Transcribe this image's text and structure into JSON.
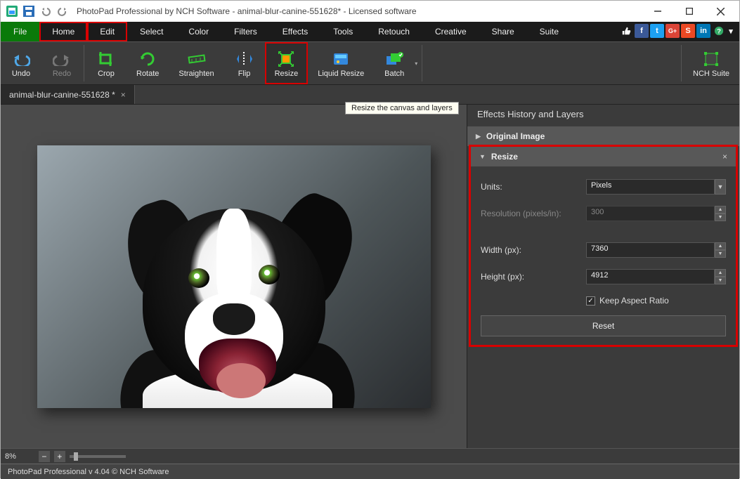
{
  "title": "PhotoPad Professional by NCH Software - animal-blur-canine-551628* - Licensed software",
  "menu": {
    "file": "File",
    "home": "Home",
    "edit": "Edit",
    "select": "Select",
    "color": "Color",
    "filters": "Filters",
    "effects": "Effects",
    "tools": "Tools",
    "retouch": "Retouch",
    "creative": "Creative",
    "share": "Share",
    "suite": "Suite"
  },
  "ribbon": {
    "undo": "Undo",
    "redo": "Redo",
    "crop": "Crop",
    "rotate": "Rotate",
    "straighten": "Straighten",
    "flip": "Flip",
    "resize": "Resize",
    "liquid": "Liquid Resize",
    "batch": "Batch",
    "nch": "NCH Suite"
  },
  "tab": {
    "name": "animal-blur-canine-551628 *",
    "close": "×"
  },
  "tooltip": "Resize the canvas and layers",
  "panel": {
    "header": "Effects History and Layers",
    "original": "Original Image",
    "resize_title": "Resize",
    "units_label": "Units:",
    "units_value": "Pixels",
    "res_label": "Resolution (pixels/in):",
    "res_value": "300",
    "width_label": "Width (px):",
    "width_value": "7360",
    "height_label": "Height (px):",
    "height_value": "4912",
    "keep_aspect": "Keep Aspect Ratio",
    "reset": "Reset",
    "close": "×"
  },
  "zoom": {
    "pct": "8%"
  },
  "status": "PhotoPad Professional v 4.04 © NCH Software",
  "social": {
    "fb": "f",
    "tw": "t",
    "gp": "G+",
    "su": "S",
    "in": "in"
  }
}
